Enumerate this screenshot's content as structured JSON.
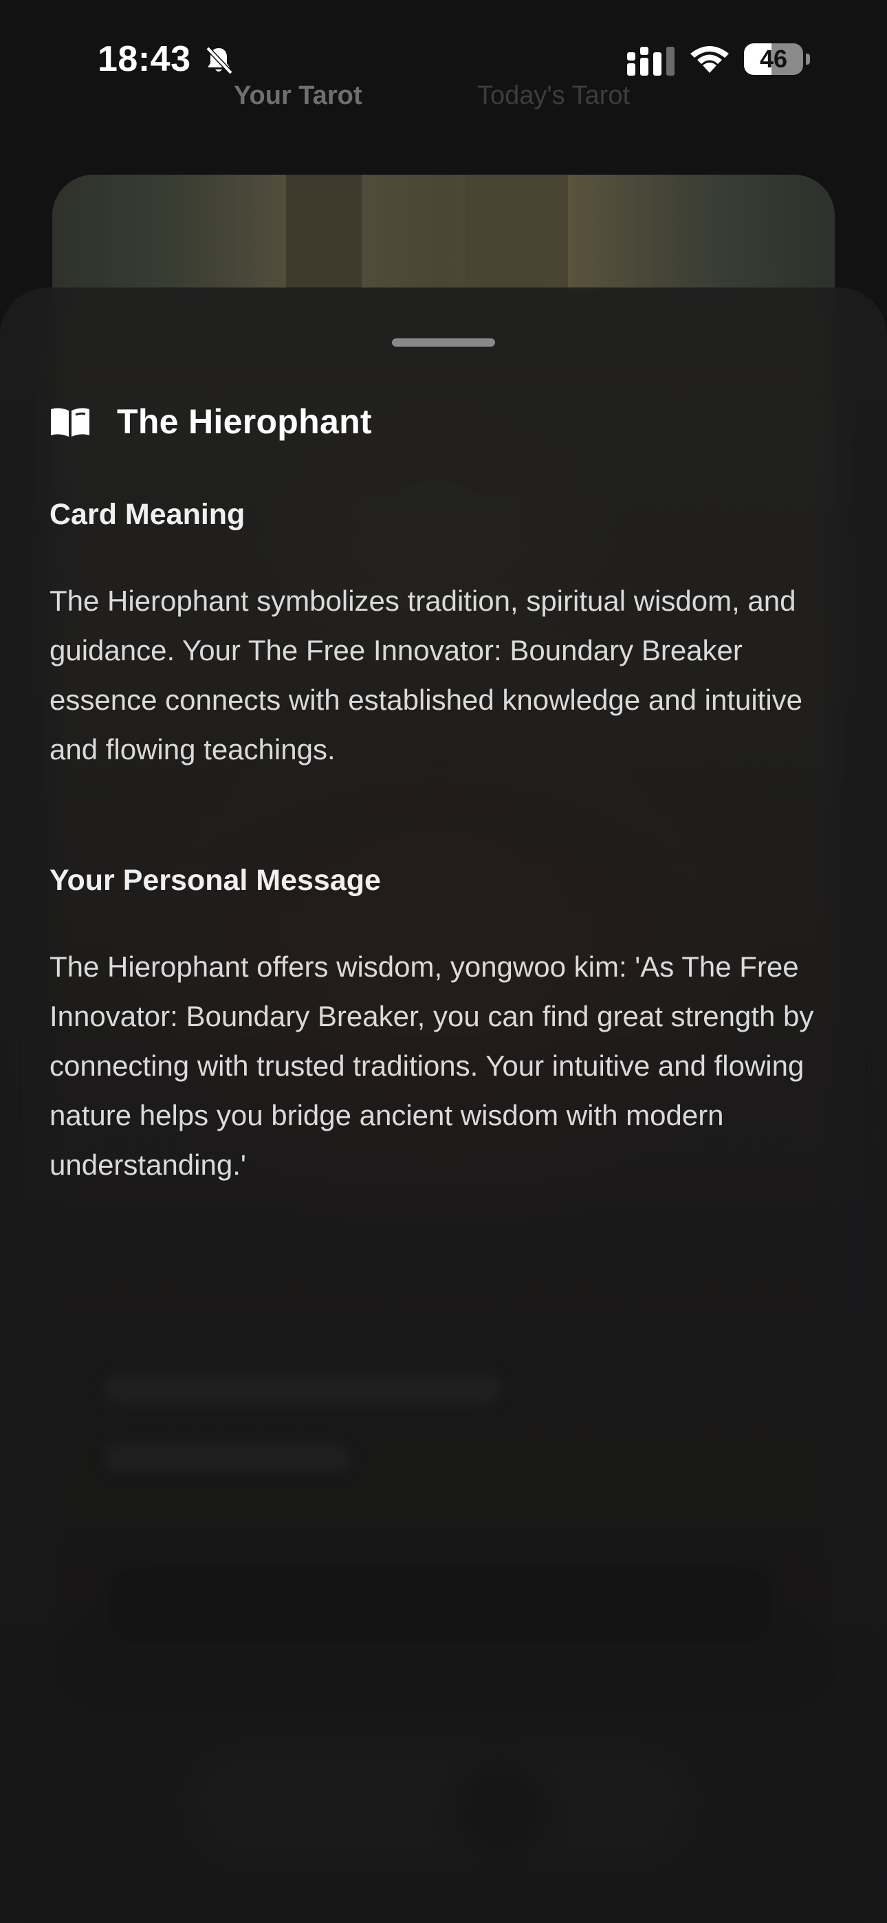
{
  "status_bar": {
    "time": "18:43",
    "battery_level": "46",
    "battery_fraction": 0.46
  },
  "tabs": [
    {
      "label": "Your Tarot"
    },
    {
      "label": "Today's Tarot"
    }
  ],
  "sheet": {
    "title": "The Hierophant",
    "sections": [
      {
        "heading": "Card Meaning",
        "body": "The Hierophant symbolizes tradition, spiritual wisdom, and guidance. Your The Free Innovator: Boundary Breaker essence connects with established knowledge and intuitive and flowing teachings."
      },
      {
        "heading": "Your Personal Message",
        "body": "The Hierophant offers wisdom, yongwoo kim: 'As The Free Innovator: Boundary Breaker, you can find great strength by connecting with trusted traditions. Your intuitive and flowing nature helps you bridge ancient wisdom with modern understanding.'"
      }
    ]
  },
  "icons": {
    "silent": "bell-slash-icon",
    "signal": "cellular-signal-icon",
    "wifi": "wifi-icon",
    "book": "open-book-icon"
  }
}
